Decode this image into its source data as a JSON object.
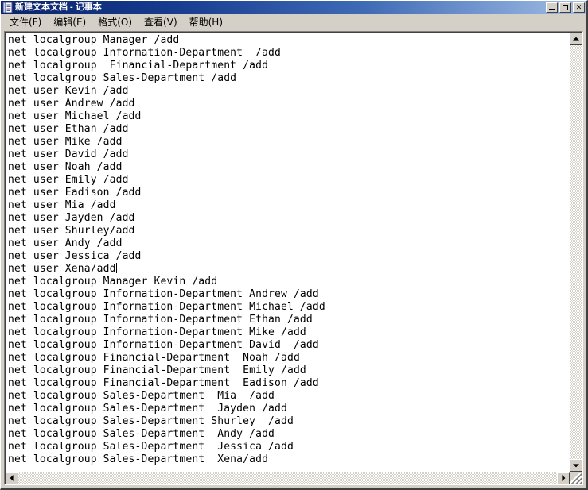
{
  "window": {
    "title": "新建文本文档 - 记事本",
    "icon": "notepad-icon",
    "controls": {
      "minimize": "_",
      "maximize": "□",
      "close": "✕"
    }
  },
  "menu": {
    "items": [
      {
        "label": "文件(F)",
        "name": "menu-file"
      },
      {
        "label": "编辑(E)",
        "name": "menu-edit"
      },
      {
        "label": "格式(O)",
        "name": "menu-format"
      },
      {
        "label": "查看(V)",
        "name": "menu-view"
      },
      {
        "label": "帮助(H)",
        "name": "menu-help"
      }
    ]
  },
  "editor": {
    "caret_line_index": 18,
    "lines": [
      "net localgroup Manager /add",
      "net localgroup Information-Department  /add",
      "net localgroup  Financial-Department /add",
      "net localgroup Sales-Department /add",
      "net user Kevin /add",
      "net user Andrew /add",
      "net user Michael /add",
      "net user Ethan /add",
      "net user Mike /add",
      "net user David /add",
      "net user Noah /add",
      "net user Emily /add",
      "net user Eadison /add",
      "net user Mia /add",
      "net user Jayden /add",
      "net user Shurley/add",
      "net user Andy /add",
      "net user Jessica /add",
      "net user Xena/add",
      "net localgroup Manager Kevin /add",
      "net localgroup Information-Department Andrew /add",
      "net localgroup Information-Department Michael /add",
      "net localgroup Information-Department Ethan /add",
      "net localgroup Information-Department Mike /add",
      "net localgroup Information-Department David  /add",
      "net localgroup Financial-Department  Noah /add",
      "net localgroup Financial-Department  Emily /add",
      "net localgroup Financial-Department  Eadison /add",
      "net localgroup Sales-Department  Mia  /add",
      "net localgroup Sales-Department  Jayden /add",
      "net localgroup Sales-Department Shurley  /add",
      "net localgroup Sales-Department  Andy /add",
      "net localgroup Sales-Department  Jessica /add",
      "net localgroup Sales-Department  Xena/add"
    ]
  },
  "scrollbars": {
    "vertical": {
      "up": "▲",
      "down": "▼"
    },
    "horizontal": {
      "left": "◀",
      "right": "▶"
    }
  },
  "colors": {
    "title_bar_start": "#0a246a",
    "title_bar_end": "#a6bfe3",
    "window_face": "#d4d0c8",
    "editor_bg": "#ffffff",
    "text": "#000000"
  }
}
